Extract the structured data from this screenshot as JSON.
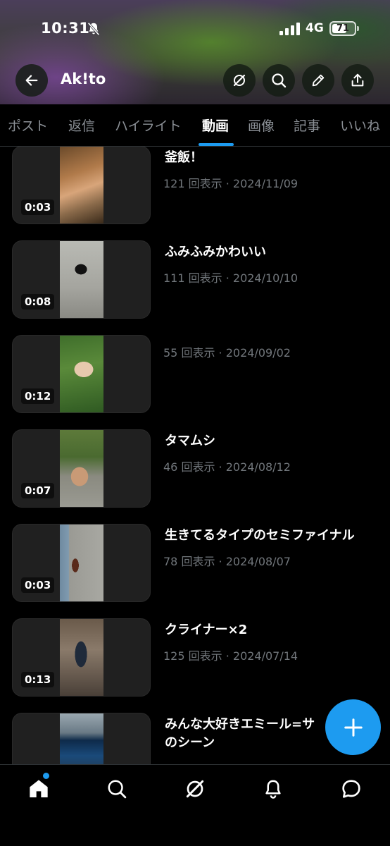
{
  "status": {
    "time": "10:31",
    "network": "4G",
    "battery": "71",
    "battery_level": 0.71
  },
  "profile": {
    "name": "Ak!to"
  },
  "icons": {
    "back": "arrow-left-icon",
    "grok": "grok-icon",
    "search": "search-icon",
    "edit": "pencil-icon",
    "share": "share-icon",
    "compose": "plus-icon",
    "home": "home-icon",
    "explore": "search-icon",
    "grok_nav": "grok-icon",
    "notifications": "bell-icon",
    "messages": "chat-bubble-icon"
  },
  "tabs": [
    {
      "label": "ポスト"
    },
    {
      "label": "返信"
    },
    {
      "label": "ハイライト"
    },
    {
      "label": "動画"
    },
    {
      "label": "画像"
    },
    {
      "label": "記事"
    },
    {
      "label": "いいね"
    }
  ],
  "active_tab": "動画",
  "videos": [
    {
      "duration": "0:03",
      "title": "釜飯！",
      "meta": "121 回表示 · 2024/11/09"
    },
    {
      "duration": "0:08",
      "title": "ふみふみかわいい",
      "meta": "111 回表示 · 2024/10/10"
    },
    {
      "duration": "0:12",
      "title": "",
      "meta": "55 回表示 · 2024/09/02"
    },
    {
      "duration": "0:07",
      "title": "タマムシ",
      "meta": "46 回表示 · 2024/08/12"
    },
    {
      "duration": "0:03",
      "title": "生きてるタイプのセミファイナル",
      "meta": "78 回表示 · 2024/08/07"
    },
    {
      "duration": "0:13",
      "title": "クライナー×2",
      "meta": "125 回表示 · 2024/07/14"
    },
    {
      "duration": "",
      "title": "みんな大好きエミール=サ",
      "title_line2": "のシーン",
      "meta": ""
    }
  ],
  "colors": {
    "accent": "#1d9bf0",
    "background": "#000000",
    "secondary_text": "#71767b"
  }
}
